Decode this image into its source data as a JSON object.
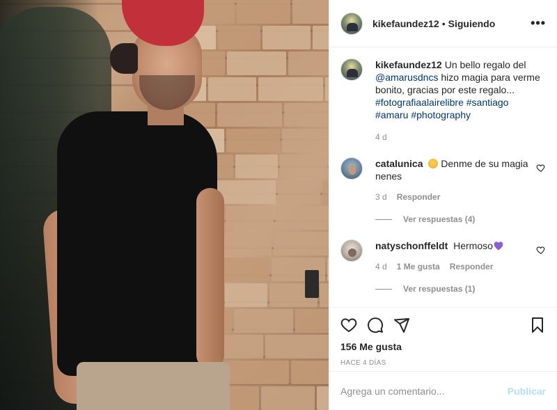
{
  "post": {
    "username": "kikefaundez12",
    "separator": "•",
    "follow_status": "Siguiendo",
    "more_icon": "more-options-icon"
  },
  "caption": {
    "username": "kikefaundez12",
    "text_1": "Un bello regalo del",
    "mention": "@amarusdncs",
    "text_2": "hizo magia para verme bonito, gracias por este regalo...",
    "hashtags": [
      "#fotografiaalairelibre",
      "#santiago",
      "#amaru",
      "#photography"
    ],
    "time": "4 d"
  },
  "comments": [
    {
      "username": "catalunica",
      "emoji": "laughing-emoji",
      "text": "Denme de su magia nenes",
      "time": "3 d",
      "reply_label": "Responder",
      "view_replies": "Ver respuestas (4)"
    },
    {
      "username": "natyschonffeldt",
      "text": "Hermoso",
      "emoji": "purple-heart-emoji",
      "time": "4 d",
      "likes_label": "1 Me gusta",
      "reply_label": "Responder",
      "view_replies": "Ver respuestas (1)"
    }
  ],
  "actions": {
    "likes": "156 Me gusta",
    "posted_ago": "HACE 4 DÍAS",
    "icons": [
      "heart-icon",
      "comment-icon",
      "share-icon",
      "save-icon"
    ]
  },
  "add_comment": {
    "placeholder": "Agrega un comentario...",
    "post_label": "Publicar"
  },
  "colors": {
    "link": "#00376b",
    "muted": "#8e8e8e",
    "publish_disabled": "#b2dffc",
    "heart_emoji": "#8e5cd9",
    "cap_red": "#c2313a"
  }
}
